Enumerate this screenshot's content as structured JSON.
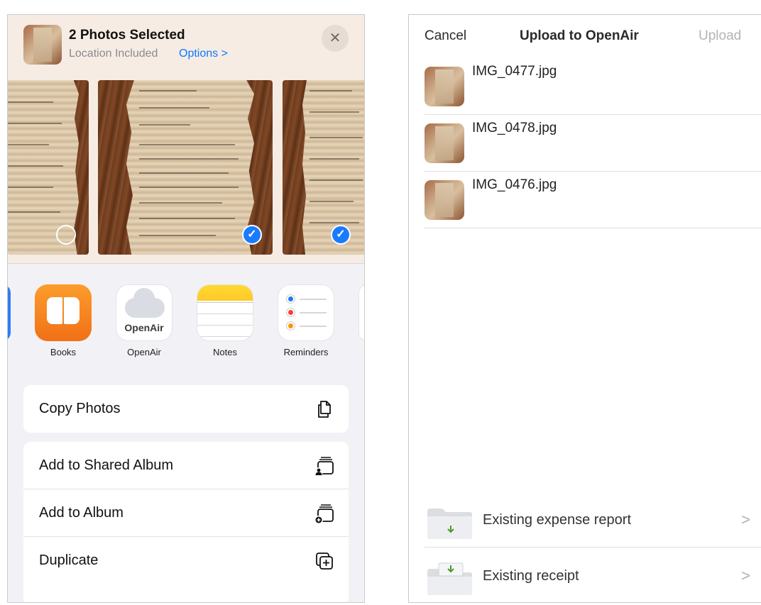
{
  "share_sheet": {
    "title": "2 Photos Selected",
    "subtitle": "Location Included",
    "options_label": "Options >",
    "close_label": "✕",
    "photos": [
      {
        "selected": false
      },
      {
        "selected": true
      },
      {
        "selected": true
      }
    ],
    "apps": [
      {
        "label": "Books",
        "icon": "books-icon"
      },
      {
        "label": "OpenAir",
        "icon": "openair-icon",
        "icon_text": "OpenAir"
      },
      {
        "label": "Notes",
        "icon": "notes-icon"
      },
      {
        "label": "Reminders",
        "icon": "reminders-icon"
      }
    ],
    "actions": [
      {
        "label": "Copy Photos",
        "icon": "copy-icon"
      },
      {
        "label": "Add to Shared Album",
        "icon": "shared-album-icon"
      },
      {
        "label": "Add to Album",
        "icon": "add-album-icon"
      },
      {
        "label": "Duplicate",
        "icon": "duplicate-icon"
      }
    ],
    "accent_color": "#0a7aff"
  },
  "upload": {
    "cancel_label": "Cancel",
    "title": "Upload to OpenAir",
    "upload_label": "Upload",
    "files": [
      {
        "name": "IMG_0477.jpg"
      },
      {
        "name": "IMG_0478.jpg"
      },
      {
        "name": "IMG_0476.jpg"
      }
    ],
    "destinations": [
      {
        "label": "Existing expense report",
        "chevron": ">",
        "icon": "folder-download-icon"
      },
      {
        "label": "Existing receipt",
        "chevron": ">",
        "icon": "folder-download-icon"
      }
    ]
  }
}
